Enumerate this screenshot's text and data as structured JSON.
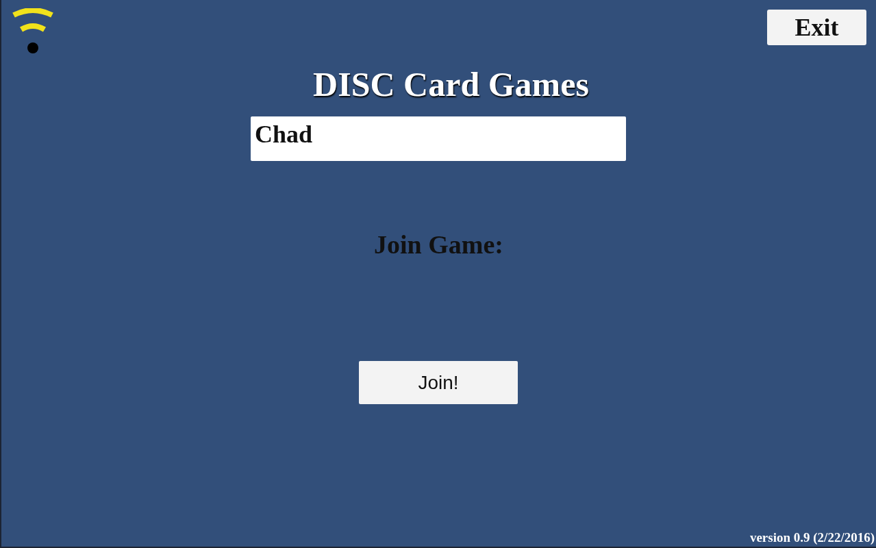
{
  "title": "DISC Card Games",
  "exit_button": {
    "label": "Exit"
  },
  "name_field": {
    "value": "Chad"
  },
  "join_label": "Join Game:",
  "join_button": {
    "label": "Join!"
  },
  "version": "version 0.9 (2/22/2016)"
}
